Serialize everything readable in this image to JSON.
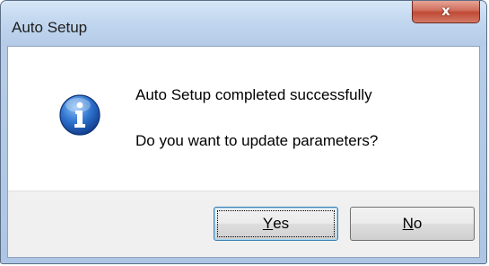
{
  "window": {
    "title": "Auto Setup",
    "close_glyph": "x"
  },
  "message": {
    "icon": "info-icon",
    "line1": "Auto Setup completed successfully",
    "line2": "Do you want to update parameters?"
  },
  "buttons": {
    "yes": {
      "mnemonic": "Y",
      "rest": "es",
      "label": "Yes",
      "default": true
    },
    "no": {
      "mnemonic": "N",
      "rest": "o",
      "label": "No"
    }
  },
  "colors": {
    "titlebar": "#c2d7ef",
    "close_button": "#c04a35",
    "info_icon": "#1f5fb8",
    "client_background": "#f0f0f0"
  }
}
